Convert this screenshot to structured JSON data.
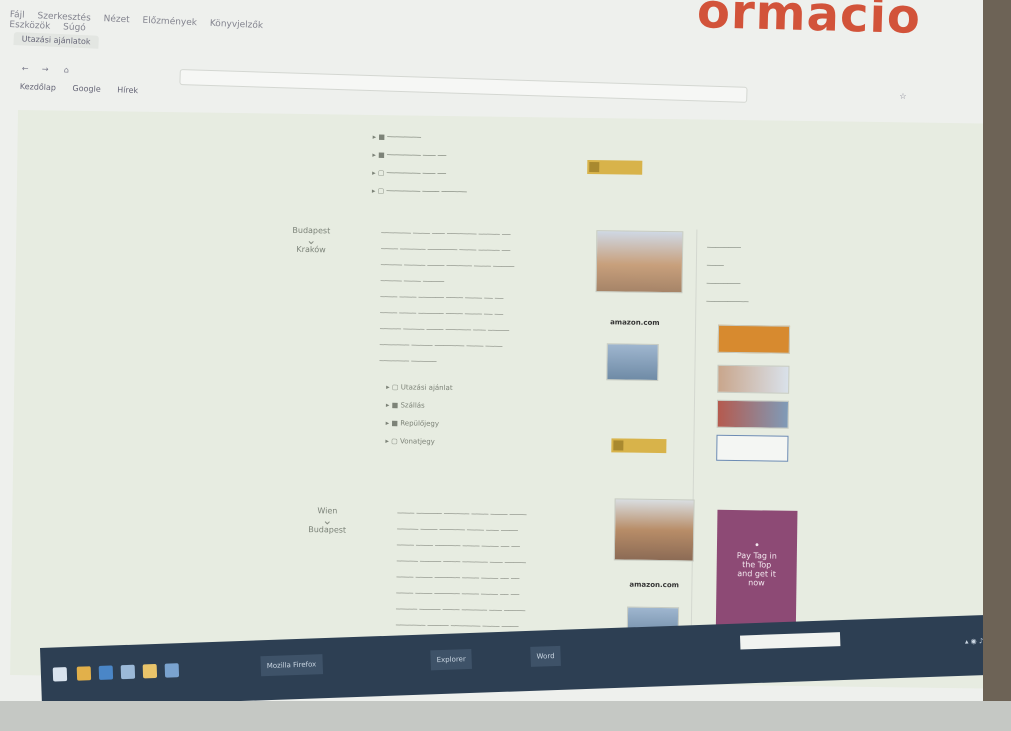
{
  "slide": {
    "heading_fragment": "ormacio"
  },
  "browser": {
    "menu_items": [
      "Fájl",
      "Szerkesztés",
      "Nézet",
      "Előzmények",
      "Könyvjelzők",
      "Eszközök",
      "Súgó"
    ],
    "tab_title": "Utazási ajánlatok",
    "bookmarks": [
      "Kezdőlap",
      "Google",
      "Hírek"
    ]
  },
  "page": {
    "sections": [
      {
        "from": "Budapest",
        "to": "Kraków",
        "bullets": [
          "Utazási ajánlat",
          "Szállás",
          "Repülőjegy",
          "Vonatjegy"
        ]
      },
      {
        "from": "Wien",
        "to": "Budapest",
        "bullets": []
      }
    ]
  },
  "ads": {
    "amazon_label": "amazon.com",
    "purple_ad_lines": [
      "Pay Tag in",
      "the Top",
      "and get it",
      "now"
    ]
  },
  "taskbar": {
    "apps": [
      "Mozilla Firefox",
      "Explorer",
      "Word"
    ]
  },
  "colors": {
    "heading": "#d2533a",
    "taskbar": "#2d3f53",
    "ad_purple": "#8d4a75",
    "button_yellow": "#d8b34a"
  }
}
